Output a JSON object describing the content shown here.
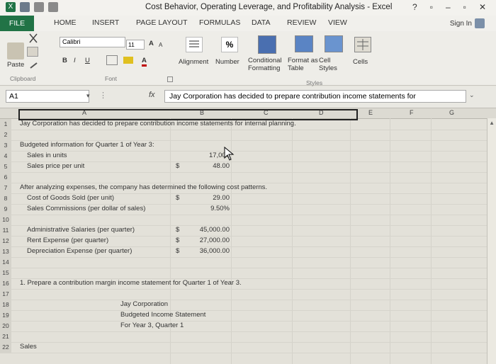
{
  "window": {
    "title": "Cost Behavior, Operating Leverage, and Profitability Analysis - Excel",
    "help": "?",
    "minimize": "–",
    "restore": "▫",
    "close": "✕"
  },
  "tabs": [
    "FILE",
    "HOME",
    "INSERT",
    "PAGE LAYOUT",
    "FORMULAS",
    "DATA",
    "REVIEW",
    "VIEW"
  ],
  "signin_label": "Sign In",
  "ribbon": {
    "paste": "Paste",
    "clipboard": "Clipboard",
    "font_name": "Calibri",
    "font_size": "11",
    "bold": "B",
    "italic": "I",
    "underline": "U",
    "grow_font": "A",
    "shrink_font": "A",
    "font_group": "Font",
    "alignment": "Alignment",
    "number": "Number",
    "percent": "%",
    "conditional_formatting": "Conditional\nFormatting",
    "format_as_table": "Format as\nTable",
    "cell_styles": "Cell\nStyles",
    "cells": "Cells",
    "styles_group": "Styles"
  },
  "formula_bar": {
    "name_box": "A1",
    "fx": "fx",
    "formula": "Jay Corporation has decided to prepare contribution income statements for"
  },
  "columns": [
    "A",
    "B",
    "C",
    "D",
    "E",
    "F",
    "G"
  ],
  "rows": [
    {
      "n": "1",
      "a": "Jay Corporation has decided to prepare contribution income statements for internal planning."
    },
    {
      "n": "2",
      "a": ""
    },
    {
      "n": "3",
      "a": "Budgeted information for Quarter 1 of Year 3:"
    },
    {
      "n": "4",
      "a": "Sales in units",
      "d": "17,000"
    },
    {
      "n": "5",
      "a": "Sales price per unit",
      "c": "$",
      "d": "48.00"
    },
    {
      "n": "6",
      "a": ""
    },
    {
      "n": "7",
      "a": "After analyzing expenses, the company has determined the following cost patterns."
    },
    {
      "n": "8",
      "a": "Cost of Goods Sold (per unit)",
      "c": "$",
      "d": "29.00"
    },
    {
      "n": "9",
      "a": "Sales Commissions (per dollar of sales)",
      "d": "9.50%"
    },
    {
      "n": "10",
      "a": ""
    },
    {
      "n": "11",
      "a": "Administrative Salaries (per quarter)",
      "c": "$",
      "d": "45,000.00"
    },
    {
      "n": "12",
      "a": "Rent Expense (per quarter)",
      "c": "$",
      "d": "27,000.00"
    },
    {
      "n": "13",
      "a": "Depreciation Expense (per quarter)",
      "c": "$",
      "d": "36,000.00"
    },
    {
      "n": "14",
      "a": ""
    },
    {
      "n": "15",
      "a": ""
    },
    {
      "n": "16",
      "a": "1. Prepare a contribution margin income statement for Quarter 1 of Year 3."
    },
    {
      "n": "17",
      "a": ""
    },
    {
      "n": "18",
      "b": "Jay Corporation"
    },
    {
      "n": "19",
      "b": "Budgeted Income Statement"
    },
    {
      "n": "20",
      "b": "For Year 3, Quarter 1"
    },
    {
      "n": "21",
      "a": ""
    },
    {
      "n": "22",
      "a": "Sales"
    }
  ],
  "colors": {
    "accent": "#217346",
    "ribbon": "#eeede8",
    "grid": "#e3e1d9"
  }
}
